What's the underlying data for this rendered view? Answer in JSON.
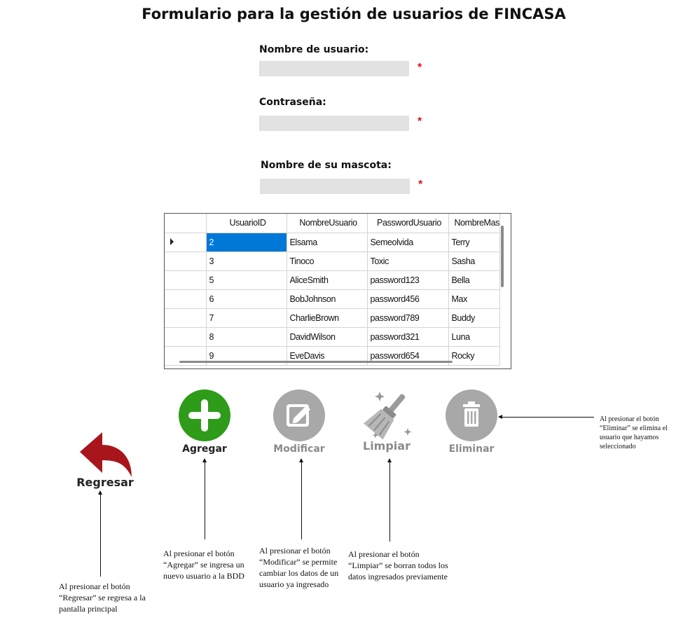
{
  "title": "Formulario para la gestión de usuarios de FINCASA",
  "form": {
    "username_label": "Nombre de usuario:",
    "username_value": "",
    "password_label": "Contraseña:",
    "password_value": "",
    "pet_label": "Nombre de su mascota:",
    "pet_value": "",
    "required_mark": "*"
  },
  "grid": {
    "columns": [
      "UsuarioID",
      "NombreUsuario",
      "PasswordUsuario",
      "NombreMas"
    ],
    "rows": [
      [
        "2",
        "Elsama",
        "Semeolvida",
        "Terry"
      ],
      [
        "3",
        "Tinoco",
        "Toxic",
        "Sasha"
      ],
      [
        "5",
        "AliceSmith",
        "password123",
        "Bella"
      ],
      [
        "6",
        "BobJohnson",
        "password456",
        "Max"
      ],
      [
        "7",
        "CharlieBrown",
        "password789",
        "Buddy"
      ],
      [
        "8",
        "DavidWilson",
        "password321",
        "Luna"
      ],
      [
        "9",
        "EveDavis",
        "password654",
        "Rocky"
      ]
    ],
    "selected_row": 0
  },
  "buttons": {
    "agregar": "Agregar",
    "modificar": "Modificar",
    "limpiar": "Limpiar",
    "eliminar": "Eliminar",
    "regresar": "Regresar"
  },
  "colors": {
    "agregar": "#2e9b19",
    "disabled_gray": "#a8a8a8",
    "regresar": "#a8161c",
    "selection": "#0078d7",
    "required": "#e0141e"
  },
  "icons": {
    "agregar": "plus-circle-icon",
    "modificar": "edit-icon",
    "limpiar": "broom-icon",
    "eliminar": "trash-icon",
    "regresar": "back-arrow-icon"
  },
  "notes": {
    "eliminar": [
      "Al presionar el botón",
      "“Eliminar” se elimina el",
      "usuario que hayamos",
      "seleccionado"
    ],
    "agregar": [
      "Al presionar el botón",
      "“Agregar” se ingresa un",
      "nuevo usuario a la BDD"
    ],
    "modificar": [
      "Al presionar el botón",
      "“Modificar” se permite",
      "cambiar los datos de un",
      "usuario ya ingresado"
    ],
    "limpiar": [
      "Al presionar el botón",
      "“Limpiar” se borran todos los",
      "datos ingresados previamente"
    ],
    "regresar": [
      "Al presionar el botón",
      "“Regresar” se regresa a la",
      "pantalla principal"
    ]
  }
}
